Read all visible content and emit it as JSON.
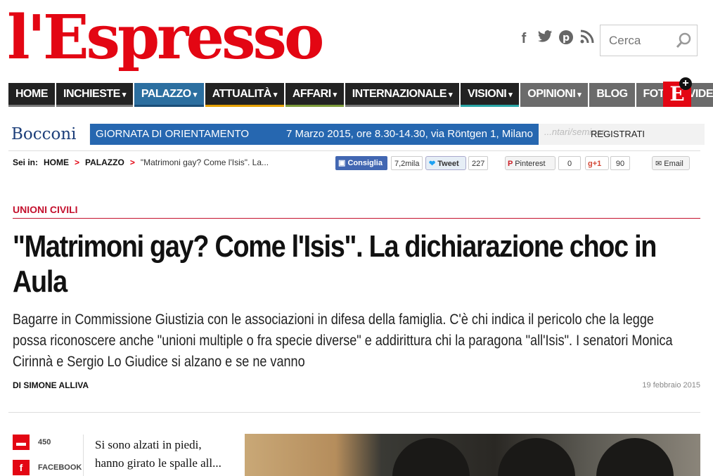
{
  "header": {
    "logo_text": "l'Espresso",
    "search_placeholder": "Cerca",
    "social_icons": [
      "facebook-icon",
      "twitter-icon",
      "pinterest-icon",
      "rss-icon"
    ]
  },
  "nav": {
    "items": [
      {
        "label": "HOME",
        "chevron": ""
      },
      {
        "label": "INCHIESTE",
        "chevron": "▾"
      },
      {
        "label": "PALAZZO",
        "chevron": "▾"
      },
      {
        "label": "ATTUALITÀ",
        "chevron": "▾"
      },
      {
        "label": "AFFARI",
        "chevron": "▾"
      },
      {
        "label": "INTERNAZIONALE",
        "chevron": "▾"
      },
      {
        "label": "VISIONI",
        "chevron": "▾"
      },
      {
        "label": "OPINIONI",
        "chevron": "▾"
      },
      {
        "label": "BLOG",
        "chevron": ""
      },
      {
        "label": "FOTO",
        "chevron": ""
      },
      {
        "label": "VIDEO",
        "chevron": ""
      }
    ],
    "badge": "E",
    "badge_plus": "+"
  },
  "ad": {
    "brand": "Bocconi",
    "left_text": "GIORNATA DI ORIENTAMENTO",
    "right_text": "7 Marzo 2015, ore 8.30-14.30, via Röntgen 1, Milano",
    "ghost": "...ntari/seminar...",
    "cta": "REGISTRATI"
  },
  "breadcrumb": {
    "prefix": "Sei in:",
    "home": "HOME",
    "section": "PALAZZO",
    "current": "\"Matrimoni gay? Come l'Isis\". La...",
    "separator": ">"
  },
  "share": {
    "facebook_label": "Consiglia",
    "facebook_count": "7,2mila",
    "twitter_label": "Tweet",
    "twitter_count": "227",
    "pinterest_label": "Pinterest",
    "pinterest_count": "0",
    "gplus_label": "g+1",
    "gplus_count": "90",
    "email_label": "Email"
  },
  "article": {
    "kicker": "UNIONI CIVILI",
    "title": "\"Matrimoni gay? Come l'Isis\". La dichiarazione choc in Aula",
    "lead": "Bagarre in Commissione Giustizia con le associazioni in difesa della famiglia. C'è chi indica il pericolo che la legge possa riconoscere anche \"unioni multiple o fra specie diverse\" e addirittura chi la paragona \"all'Isis\". I senatori Monica Cirinnà e Sergio Lo Giudice si alzano e se ne vanno",
    "author": "DI SIMONE ALLIVA",
    "date": "19 febbraio 2015",
    "comments_count": "450",
    "facebook_label": "FACEBOOK",
    "body": "Si sono alzati in piedi, hanno girato le spalle all..."
  },
  "colors": {
    "brand_red": "#e30613",
    "nav_dark": "#222222",
    "nav_active": "#2c6fa0",
    "kicker_red": "#c4112e"
  }
}
